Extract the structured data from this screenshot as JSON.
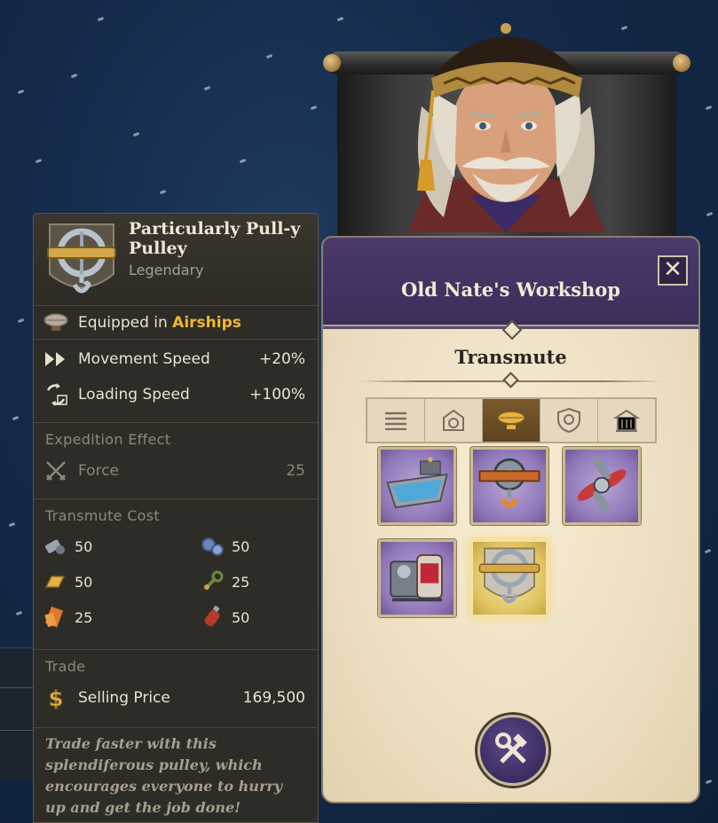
{
  "item": {
    "name": "Particularly Pull-y Pulley",
    "rarity": "Legendary",
    "equip_prefix": "Equipped in ",
    "equip_target": "Airships",
    "stats": [
      {
        "label": "Movement Speed",
        "value": "+20%",
        "icon": "double-arrow-icon"
      },
      {
        "label": "Loading Speed",
        "value": "+100%",
        "icon": "loading-cycle-icon"
      }
    ],
    "expedition": {
      "title": "Expedition Effect",
      "label": "Force",
      "value": "25",
      "icon": "crossed-swords-icon"
    },
    "transmute_cost": {
      "title": "Transmute Cost",
      "items": [
        {
          "icon": "screw-bolts-icon",
          "value": "50"
        },
        {
          "icon": "blue-gears-icon",
          "value": "50"
        },
        {
          "icon": "gold-bar-icon",
          "value": "50"
        },
        {
          "icon": "green-wrench-icon",
          "value": "25"
        },
        {
          "icon": "orange-scroll-icon",
          "value": "25"
        },
        {
          "icon": "red-canister-icon",
          "value": "50"
        }
      ]
    },
    "trade": {
      "title": "Trade",
      "label": "Selling Price",
      "value": "169,500",
      "icon": "dollar-icon"
    },
    "flavor": "Trade faster with this splendiferous pulley, which encourages everyone to hurry up and get the job done!"
  },
  "workshop": {
    "title": "Old Nate's Workshop",
    "subtitle": "Transmute",
    "close_label": "✕",
    "tabs": [
      {
        "icon": "list-icon",
        "active": false
      },
      {
        "icon": "building-gear-icon",
        "active": false
      },
      {
        "icon": "airship-icon",
        "active": true
      },
      {
        "icon": "shield-gear-icon",
        "active": false
      },
      {
        "icon": "town-hall-icon",
        "active": false
      }
    ],
    "slots": [
      {
        "item": "boat-hull",
        "selected": false
      },
      {
        "item": "pulley-orange",
        "selected": false
      },
      {
        "item": "propeller",
        "selected": false
      },
      {
        "item": "engine-machine",
        "selected": false
      },
      {
        "item": "pulley-legendary",
        "selected": true
      }
    ],
    "craft_icon": "hammer-wrench-icon"
  },
  "colors": {
    "accent_gold": "#f3b630",
    "header_purple": "#3c2d5a",
    "panel_dark": "#2e2c27",
    "parchment": "#efe3c8",
    "slot_purple": "#8f77b8",
    "slot_gold": "#e2c666"
  }
}
